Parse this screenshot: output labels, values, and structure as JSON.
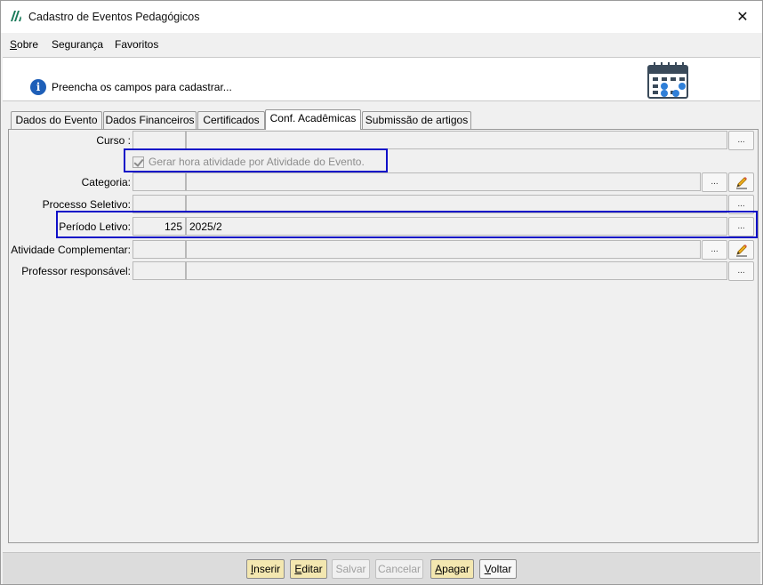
{
  "window": {
    "title": "Cadastro de Eventos Pedagógicos",
    "close_glyph": "✕"
  },
  "menu": {
    "items": [
      {
        "label_accel": "S",
        "label_rest": "obre"
      },
      {
        "label": "Segurança"
      },
      {
        "label": "Favoritos"
      }
    ]
  },
  "info": {
    "icon_glyph": "i",
    "text": "Preencha os campos para cadastrar..."
  },
  "tabs": [
    {
      "label": "Dados do Evento"
    },
    {
      "label": "Dados Financeiros"
    },
    {
      "label": "Certificados"
    },
    {
      "label": "Conf. Acadêmicas"
    },
    {
      "label": "Submissão de artigos"
    }
  ],
  "form": {
    "curso": {
      "label": "Curso :",
      "code": "",
      "value": ""
    },
    "checkbox": {
      "label": "Gerar hora atividade por Atividade do Evento.",
      "checked": true,
      "enabled": false
    },
    "categoria": {
      "label": "Categoria:",
      "code": "",
      "value": ""
    },
    "processo_seletivo": {
      "label": "Processo Seletivo:",
      "code": "",
      "value": ""
    },
    "periodo_letivo": {
      "label": "Período Letivo:",
      "code": "125",
      "value": "2025/2"
    },
    "atividade_complementar": {
      "label": "Atividade Complementar:",
      "code": "",
      "value": ""
    },
    "professor_responsavel": {
      "label": "Professor responsável:",
      "code": "",
      "value": ""
    },
    "ellipsis_label": "..."
  },
  "buttons": {
    "inserir": {
      "accel": "I",
      "rest": "nserir",
      "state": "enabled"
    },
    "editar": {
      "accel": "E",
      "rest": "ditar",
      "state": "enabled"
    },
    "salvar": {
      "accel": "",
      "rest": "Salvar",
      "state": "disabled"
    },
    "cancelar": {
      "accel": "",
      "rest": "Cancelar",
      "state": "disabled"
    },
    "apagar": {
      "accel": "A",
      "rest": "pagar",
      "state": "enabled"
    },
    "voltar": {
      "accel": "V",
      "rest": "oltar",
      "state": "neutral"
    }
  },
  "colors": {
    "highlight": "#1010c8",
    "button_enabled": "#f3e7b0",
    "info_icon": "#1e5fb8"
  }
}
